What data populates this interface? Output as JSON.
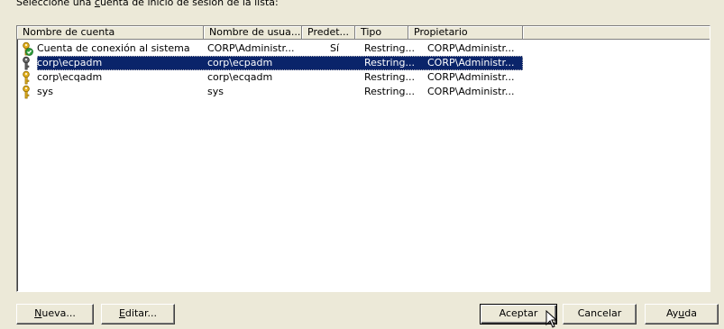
{
  "caption": {
    "before": "Seleccione una ",
    "accel": "c",
    "after": "uenta de inicio de sesión de la lista:"
  },
  "columns": [
    "Nombre de cuenta",
    "Nombre de usua...",
    "Predet...",
    "Tipo",
    "Propietario"
  ],
  "rows": [
    {
      "name": "Cuenta de conexión al sistema",
      "user": "CORP\\Administr...",
      "default": "Sí",
      "type": "Restring...",
      "owner": "CORP\\Administr...",
      "icon": "key-check-icon",
      "selected": false
    },
    {
      "name": "corp\\ecpadm",
      "user": "corp\\ecpadm",
      "default": "",
      "type": "Restring...",
      "owner": "CORP\\Administr...",
      "icon": "key-gray-icon",
      "selected": true
    },
    {
      "name": "corp\\ecqadm",
      "user": "corp\\ecqadm",
      "default": "",
      "type": "Restring...",
      "owner": "CORP\\Administr...",
      "icon": "key-icon",
      "selected": false
    },
    {
      "name": "sys",
      "user": "sys",
      "default": "",
      "type": "Restring...",
      "owner": "CORP\\Administr...",
      "icon": "key-icon",
      "selected": false
    }
  ],
  "buttons": {
    "new": {
      "accel": "N",
      "rest": "ueva..."
    },
    "edit": {
      "accel": "E",
      "rest": "ditar..."
    },
    "accept": "Aceptar",
    "cancel": "Cancelar",
    "help": {
      "before": "Ay",
      "accel": "u",
      "after": "da"
    }
  },
  "colors": {
    "dialog_bg": "#ece9d8",
    "selection": "#0a246a",
    "key_gold": "#e6b422",
    "check_green": "#2e9e3a"
  }
}
